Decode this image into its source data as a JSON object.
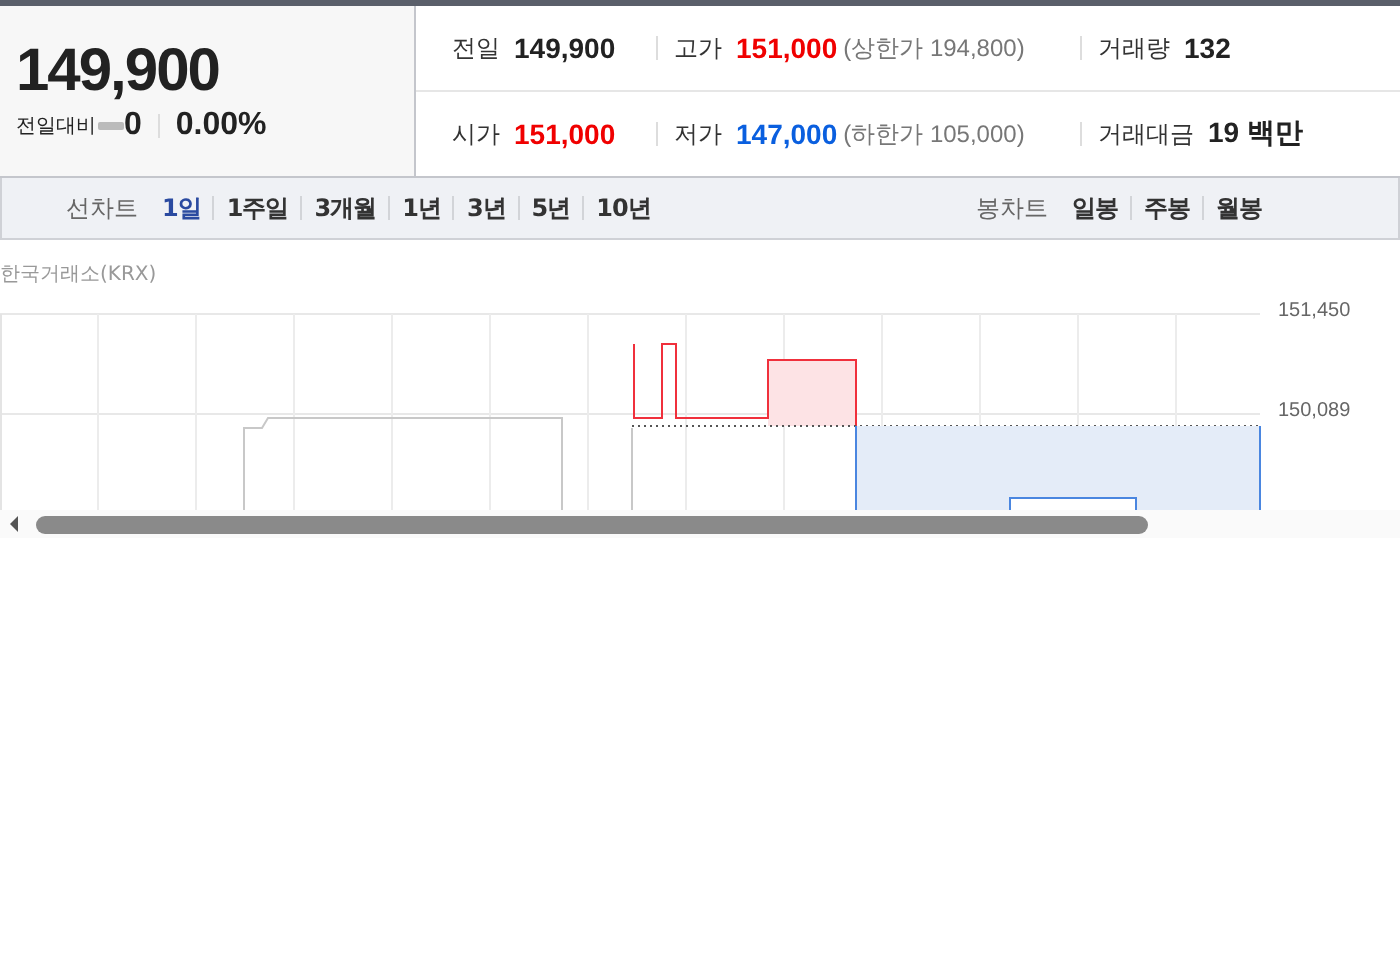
{
  "quote": {
    "price": "149,900",
    "change_label": "전일대비",
    "unchanged": true,
    "change": "0",
    "rate": "0.00%"
  },
  "stats": [
    [
      {
        "label": "전일",
        "value": "149,900",
        "kind": "plain"
      },
      {
        "label": "고가",
        "value": "151,000",
        "kind": "up",
        "note": "(상한가 194,800)"
      },
      {
        "label": "거래량",
        "value": "132",
        "kind": "plain"
      }
    ],
    [
      {
        "label": "시가",
        "value": "151,000",
        "kind": "up"
      },
      {
        "label": "저가",
        "value": "147,000",
        "kind": "down",
        "note": "(하한가 105,000)"
      },
      {
        "label": "거래대금",
        "value": "19 백만",
        "kind": "plain"
      }
    ]
  ],
  "line_chart_tabs": {
    "label": "선차트",
    "periods": [
      {
        "label": "1일",
        "selected": true
      },
      {
        "label": "1주일",
        "selected": false
      },
      {
        "label": "3개월",
        "selected": false
      },
      {
        "label": "1년",
        "selected": false
      },
      {
        "label": "3년",
        "selected": false
      },
      {
        "label": "5년",
        "selected": false
      },
      {
        "label": "10년",
        "selected": false
      }
    ]
  },
  "candle_chart_tabs": {
    "label": "봉차트",
    "periods": [
      {
        "label": "일봉",
        "selected": false
      },
      {
        "label": "주봉",
        "selected": false
      },
      {
        "label": "월봉",
        "selected": false
      }
    ]
  },
  "chart": {
    "source": "한국거래소(KRX)",
    "y_labels": [
      "151,450",
      "150,089"
    ]
  }
}
